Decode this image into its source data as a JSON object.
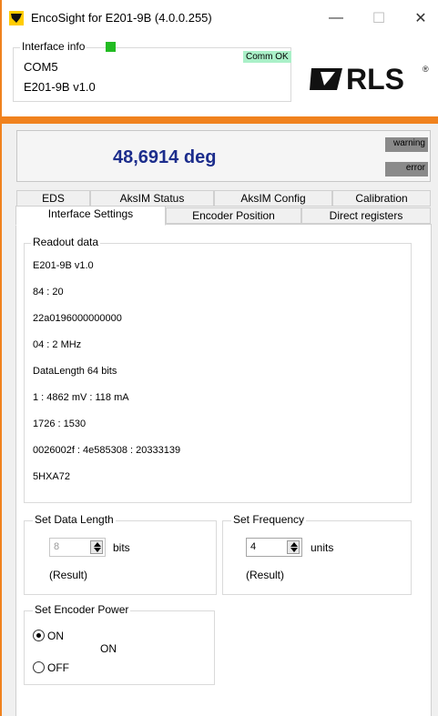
{
  "window": {
    "title": "EncoSight for E201-9B (4.0.0.255)",
    "minimize": "—",
    "maximize": "☐",
    "close": "✕"
  },
  "interface_info": {
    "legend": "Interface info",
    "port": "COM5",
    "device": "E201-9B v1.0",
    "comm_status": "Comm OK",
    "led_color": "#22bb22"
  },
  "logo": {
    "text": "RLS",
    "mark": "®"
  },
  "readout": {
    "angle": "48,6914 deg",
    "warning": "warning",
    "error": "error"
  },
  "tabs": {
    "row1": [
      "EDS",
      "AksIM Status",
      "AksIM Config",
      "Calibration"
    ],
    "row2": [
      "Interface Settings",
      "Encoder Position",
      "Direct registers"
    ],
    "active": "Interface Settings"
  },
  "readout_data": {
    "legend": "Readout data",
    "lines": [
      "E201-9B v1.0",
      "84 : 20",
      "22a0196000000000",
      "04 : 2 MHz",
      "DataLength 64 bits",
      "1 : 4862 mV : 118 mA",
      "1726 : 1530",
      "0026002f : 4e585308 : 20333139",
      "5HXA72"
    ]
  },
  "set_data_length": {
    "legend": "Set Data Length",
    "value": "8",
    "unit": "bits",
    "result": "(Result)"
  },
  "set_frequency": {
    "legend": "Set Frequency",
    "value": "4",
    "unit": "units",
    "result": "(Result)"
  },
  "set_encoder_power": {
    "legend": "Set Encoder Power",
    "on_label": "ON",
    "off_label": "OFF",
    "state": "ON",
    "selected": "ON"
  },
  "colors": {
    "accent": "#f0821e",
    "angle_text": "#1c2d8c",
    "status_pill": "#8a8a8a",
    "comm_ok_bg": "#aaf0c8"
  }
}
